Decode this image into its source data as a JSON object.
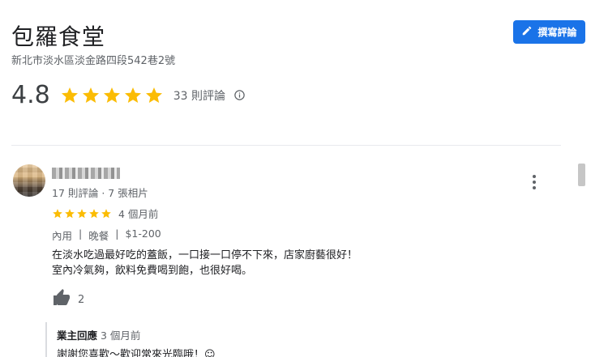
{
  "place": {
    "name": "包羅食堂",
    "address": "新北市淡水區淡金路四段542巷2號",
    "rating": "4.8",
    "review_count_text": "33 則評論",
    "stars": 5
  },
  "header": {
    "write_review_label": "撰寫評論"
  },
  "icons": {
    "write": "pencil-icon",
    "info": "info-icon",
    "more": "more-vert-icon",
    "like": "thumb-up-icon"
  },
  "colors": {
    "accent": "#1a73e8",
    "star": "#fbbc04",
    "muted_text": "#5f6368"
  },
  "review": {
    "reviewer_meta": "17 則評論 · 7 張相片",
    "stars": 5,
    "time": "4 個月前",
    "tags": [
      "內用",
      "|",
      "晚餐",
      "|",
      "$1-200"
    ],
    "text_line1": "在淡水吃過最好吃的蓋飯，一口接一口停不下來，店家廚藝很好！",
    "text_line2": "室內冷氣夠，飲料免費喝到飽，也很好喝。",
    "likes": "2",
    "owner_reply": {
      "label": "業主回應",
      "time": "3 個月前",
      "text": "謝謝您喜歡～歡迎常來光臨哦！☺"
    }
  }
}
